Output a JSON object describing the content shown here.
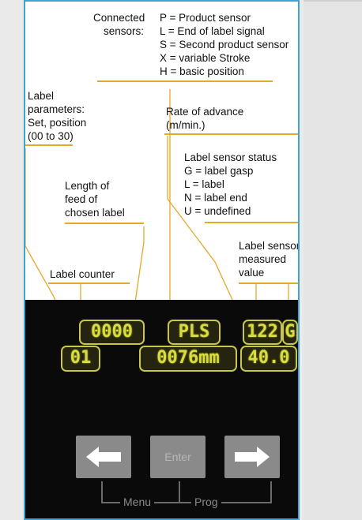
{
  "connected": {
    "heading_line1": "Connected",
    "heading_line2": "sensors:",
    "items": [
      "P = Product sensor",
      "L = End of label signal",
      "S = Second product sensor",
      "X = variable Stroke",
      "H = basic position"
    ]
  },
  "label_params": [
    "Label",
    "parameters:",
    "Set, position",
    "(00 to 30)"
  ],
  "rate": [
    "Rate of advance",
    "(m/min.)"
  ],
  "status": {
    "heading": "Label sensor status",
    "items": [
      "G = label gasp",
      "L = label",
      "N = label end",
      "U = undefined"
    ]
  },
  "length": [
    "Length of",
    "feed of",
    "chosen label"
  ],
  "measured": [
    "Label sensor –",
    "measured",
    "value"
  ],
  "counter": "Label counter",
  "display": {
    "row1": [
      "0000",
      "PLS",
      "122",
      "G"
    ],
    "row2": [
      "01",
      "0076mm",
      "40.0"
    ]
  },
  "controls": {
    "enter": "Enter",
    "menu": "Menu",
    "prog": "Prog",
    "left_icon": "left-arrow-icon",
    "right_icon": "right-arrow-icon"
  },
  "colors": {
    "frame": "#3ba6d6",
    "leader": "#e4a82a",
    "lcd": "#d8dc3e"
  }
}
